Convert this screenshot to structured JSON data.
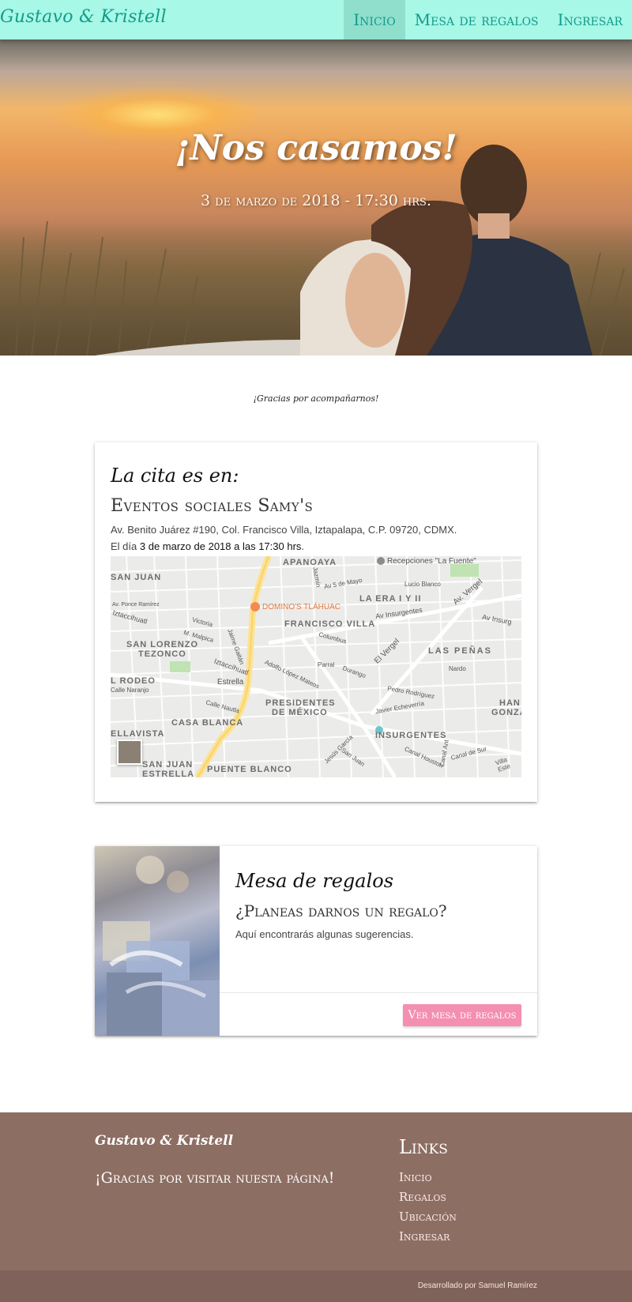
{
  "nav": {
    "brand": "Gustavo & Kristell",
    "links": [
      "Inicio",
      "Mesa de regalos",
      "Ingresar"
    ],
    "active": "Inicio",
    "bg_color": "#a7f8e6",
    "text_color": "#139b8c"
  },
  "hero": {
    "title": "¡Nos casamos!",
    "date": "3 de marzo de 2018 - 17:30 hrs."
  },
  "thanks": "¡Gracias por acompañarnos!",
  "location_card": {
    "heading": "La cita es en:",
    "venue": "Eventos sociales Samy's",
    "address": "Av. Benito Juárez #190, Col. Francisco Villa, Iztapalapa, C.P. 09720, CDMX.",
    "date_prefix": "El día",
    "date_bold": "3 de marzo de 2018 a las 17:30 hrs",
    "date_suffix": ".",
    "map": {
      "labels": {
        "apanoaya": "APANOAYA",
        "recepciones": "Recepciones \"La Fuente\"",
        "san_juan": "SAN JUAN",
        "la_era": "LA ERA I Y II",
        "dominos": "DOMINO'S TLÁHUAC",
        "francisco_villa": "FRANCISCO VILLA",
        "san_lorenzo": "SAN LORENZO",
        "tezonco": "TEZONCO",
        "las_penas": "LAS PEÑAS",
        "el_rodeo": "L RODEO",
        "presidentes": "PRESIDENTES",
        "de_mexico": "DE MÉXICO",
        "han": "HAN",
        "gonza": "GONZÁ",
        "casa_blanca": "CASA BLANCA",
        "ellavista": "ELLAVISTA",
        "insurgentes": "INSURGENTES",
        "san_juan_estrella": "SAN JUAN",
        "estrella": "ESTRELLA",
        "puente_blanco": "PUENTE BLANCO",
        "estrella_st": "Estrella",
        "iztaccihuatl": "Iztaccíhuatl",
        "iztaccihuatl2": "Iztaccihuatl",
        "av_insurgentes": "Av Insurgentes",
        "el_vergel": "El Vergel",
        "av_vergel": "Av. Vergel",
        "av_insurg2": "Av Insurg",
        "av5mayo": "Av 5 de Mayo",
        "lucio_blanco": "Lucio Blanco",
        "columbus": "Columbus",
        "parral": "Parral",
        "durango": "Durango",
        "adolfo": "Adolfo López Mateos",
        "pedro": "Pedro Rodríguez",
        "javier": "Javier Echeverría",
        "nardo": "Nardo",
        "canal": "Calle Nautla",
        "calle_norte": "Calle Naranjo",
        "av_ponce": "Av. Ponce Ramírez",
        "victoria": "Victoria",
        "m_malpica": "M. Malpica",
        "jaime": "Jaime Gaitán",
        "sin_ciudad": "San Lorenzo",
        "canal_sur": "Canal de Sur",
        "villa_este": "Villa Este",
        "jesus_garcia": "Jesús García",
        "san_juan_st": "San Juan",
        "canal_houston": "Canal Houston",
        "canal_ant": "Canal Ant",
        "jazmin": "Jazmín"
      }
    }
  },
  "gift_card": {
    "heading": "Mesa de regalos",
    "subheading": "¿Planeas darnos un regalo?",
    "description": "Aquí encontrarás algunas sugerencias.",
    "button": "Ver mesa de regalos",
    "button_color": "#f48fb1"
  },
  "footer": {
    "brand": "Gustavo & Kristell",
    "thanks": "¡Gracias por visitar nuesta página!",
    "links_title": "Links",
    "links": [
      "Inicio",
      "Regalos",
      "Ubicación",
      "Ingresar"
    ],
    "bg_color": "#8d6e63",
    "copyright": "Desarrollado por Samuel Ramírez"
  }
}
